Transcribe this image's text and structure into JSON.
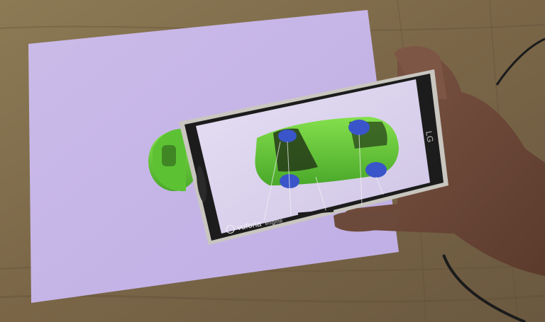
{
  "scene": {
    "description_free": true,
    "colors": {
      "table": "#8a7554",
      "paper": "#c7b6e8",
      "car": "#6cd13a",
      "phone_bezel": "#1c1c1c",
      "phone_frame": "#c9c6c0",
      "marker_blue": "#3a55c9",
      "skin": "#6e4a3a"
    }
  },
  "phone": {
    "brand_text": "LG",
    "watermark_text": "vuforia",
    "watermark_subtext": "engine"
  }
}
